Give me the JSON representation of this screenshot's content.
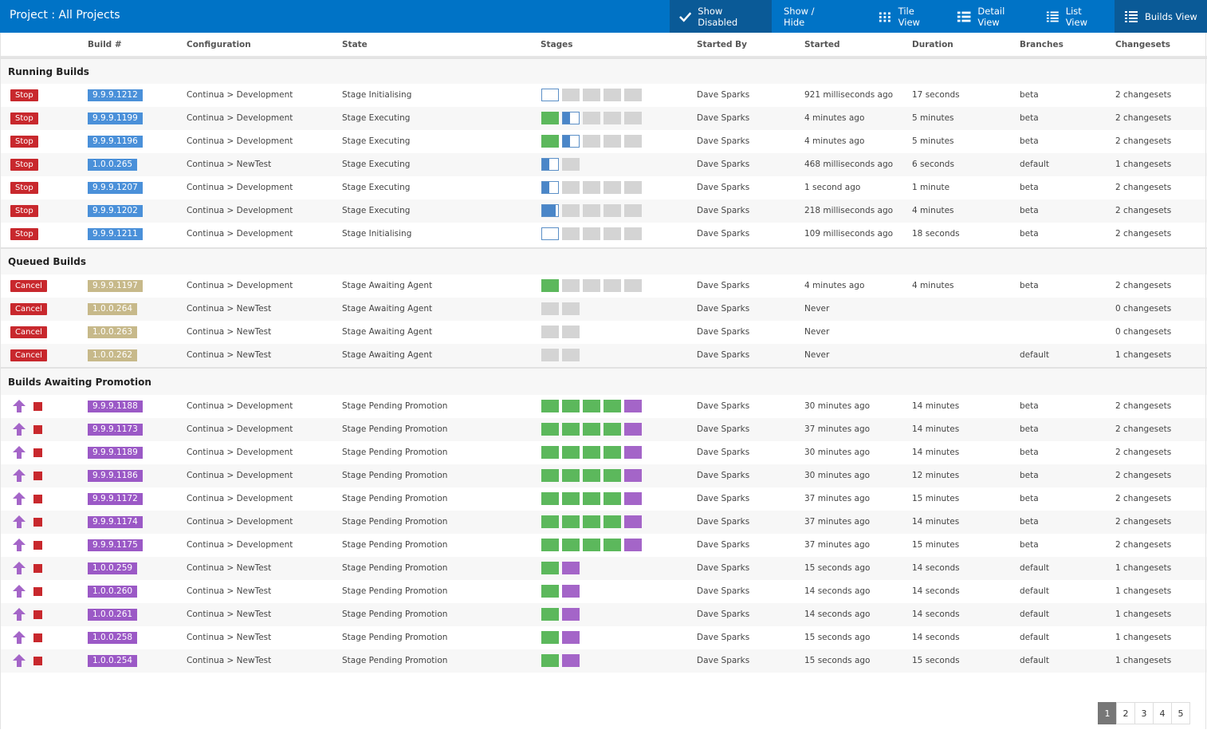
{
  "title": "Project : All Projects",
  "toolbar": {
    "show_disabled": "Show Disabled",
    "show_hide": "Show / Hide",
    "tile_view": "Tile View",
    "detail_view": "Detail View",
    "list_view": "List View",
    "builds_view": "Builds View"
  },
  "columns": [
    "Build #",
    "Configuration",
    "State",
    "Stages",
    "Started By",
    "Started",
    "Duration",
    "Branches",
    "Changesets"
  ],
  "colors": {
    "header": "#0073c6",
    "stop": "#c8282d",
    "running_badge": "#4a90d9",
    "queued_badge": "#c7b98a",
    "promotion_badge": "#9b59c6",
    "stage_done": "#5cb85c",
    "stage_promotion": "#a465c8",
    "stage_pending": "#d4d4d4"
  },
  "sections": {
    "running": {
      "title": "Running Builds",
      "action": "Stop",
      "rows": [
        {
          "build": "9.9.9.1212",
          "config": "Continua > Development",
          "state": "Stage Initialising",
          "stages": [
            "empty",
            "grey",
            "grey",
            "grey",
            "grey"
          ],
          "by": "Dave Sparks",
          "started": "921 milliseconds ago",
          "duration": "17 seconds",
          "branch": "beta",
          "changesets": "2 changesets"
        },
        {
          "build": "9.9.9.1199",
          "config": "Continua > Development",
          "state": "Stage Executing",
          "stages": [
            "green",
            "half",
            "grey",
            "grey",
            "grey"
          ],
          "by": "Dave Sparks",
          "started": "4 minutes ago",
          "duration": "5 minutes",
          "branch": "beta",
          "changesets": "2 changesets"
        },
        {
          "build": "9.9.9.1196",
          "config": "Continua > Development",
          "state": "Stage Executing",
          "stages": [
            "green",
            "half",
            "grey",
            "grey",
            "grey"
          ],
          "by": "Dave Sparks",
          "started": "4 minutes ago",
          "duration": "5 minutes",
          "branch": "beta",
          "changesets": "2 changesets"
        },
        {
          "build": "1.0.0.265",
          "config": "Continua > NewTest",
          "state": "Stage Executing",
          "stages": [
            "half",
            "grey"
          ],
          "by": "Dave Sparks",
          "started": "468 milliseconds ago",
          "duration": "6 seconds",
          "branch": "default",
          "changesets": "1 changesets"
        },
        {
          "build": "9.9.9.1207",
          "config": "Continua > Development",
          "state": "Stage Executing",
          "stages": [
            "half",
            "grey",
            "grey",
            "grey",
            "grey"
          ],
          "by": "Dave Sparks",
          "started": "1 second ago",
          "duration": "1 minute",
          "branch": "beta",
          "changesets": "2 changesets"
        },
        {
          "build": "9.9.9.1202",
          "config": "Continua > Development",
          "state": "Stage Executing",
          "stages": [
            "most",
            "grey",
            "grey",
            "grey",
            "grey"
          ],
          "by": "Dave Sparks",
          "started": "218 milliseconds ago",
          "duration": "4 minutes",
          "branch": "beta",
          "changesets": "2 changesets"
        },
        {
          "build": "9.9.9.1211",
          "config": "Continua > Development",
          "state": "Stage Initialising",
          "stages": [
            "empty",
            "grey",
            "grey",
            "grey",
            "grey"
          ],
          "by": "Dave Sparks",
          "started": "109 milliseconds ago",
          "duration": "18 seconds",
          "branch": "beta",
          "changesets": "2 changesets"
        }
      ]
    },
    "queued": {
      "title": "Queued Builds",
      "action": "Cancel",
      "rows": [
        {
          "build": "9.9.9.1197",
          "config": "Continua > Development",
          "state": "Stage Awaiting Agent",
          "stages": [
            "green",
            "grey",
            "grey",
            "grey",
            "grey"
          ],
          "by": "Dave Sparks",
          "started": "4 minutes ago",
          "duration": "4 minutes",
          "branch": "beta",
          "changesets": "2 changesets"
        },
        {
          "build": "1.0.0.264",
          "config": "Continua > NewTest",
          "state": "Stage Awaiting Agent",
          "stages": [
            "grey",
            "grey"
          ],
          "by": "Dave Sparks",
          "started": "Never",
          "duration": "",
          "branch": "",
          "changesets": "0 changesets"
        },
        {
          "build": "1.0.0.263",
          "config": "Continua > NewTest",
          "state": "Stage Awaiting Agent",
          "stages": [
            "grey",
            "grey"
          ],
          "by": "Dave Sparks",
          "started": "Never",
          "duration": "",
          "branch": "",
          "changesets": "0 changesets"
        },
        {
          "build": "1.0.0.262",
          "config": "Continua > NewTest",
          "state": "Stage Awaiting Agent",
          "stages": [
            "grey",
            "grey"
          ],
          "by": "Dave Sparks",
          "started": "Never",
          "duration": "",
          "branch": "default",
          "changesets": "1 changesets"
        }
      ]
    },
    "promotion": {
      "title": "Builds Awaiting Promotion",
      "rows": [
        {
          "build": "9.9.9.1188",
          "config": "Continua > Development",
          "state": "Stage Pending Promotion",
          "stages": [
            "green",
            "green",
            "green",
            "green",
            "purple"
          ],
          "by": "Dave Sparks",
          "started": "30 minutes ago",
          "duration": "14 minutes",
          "branch": "beta",
          "changesets": "2 changesets"
        },
        {
          "build": "9.9.9.1173",
          "config": "Continua > Development",
          "state": "Stage Pending Promotion",
          "stages": [
            "green",
            "green",
            "green",
            "green",
            "purple"
          ],
          "by": "Dave Sparks",
          "started": "37 minutes ago",
          "duration": "14 minutes",
          "branch": "beta",
          "changesets": "2 changesets"
        },
        {
          "build": "9.9.9.1189",
          "config": "Continua > Development",
          "state": "Stage Pending Promotion",
          "stages": [
            "green",
            "green",
            "green",
            "green",
            "purple"
          ],
          "by": "Dave Sparks",
          "started": "30 minutes ago",
          "duration": "14 minutes",
          "branch": "beta",
          "changesets": "2 changesets"
        },
        {
          "build": "9.9.9.1186",
          "config": "Continua > Development",
          "state": "Stage Pending Promotion",
          "stages": [
            "green",
            "green",
            "green",
            "green",
            "purple"
          ],
          "by": "Dave Sparks",
          "started": "30 minutes ago",
          "duration": "12 minutes",
          "branch": "beta",
          "changesets": "2 changesets"
        },
        {
          "build": "9.9.9.1172",
          "config": "Continua > Development",
          "state": "Stage Pending Promotion",
          "stages": [
            "green",
            "green",
            "green",
            "green",
            "purple"
          ],
          "by": "Dave Sparks",
          "started": "37 minutes ago",
          "duration": "15 minutes",
          "branch": "beta",
          "changesets": "2 changesets"
        },
        {
          "build": "9.9.9.1174",
          "config": "Continua > Development",
          "state": "Stage Pending Promotion",
          "stages": [
            "green",
            "green",
            "green",
            "green",
            "purple"
          ],
          "by": "Dave Sparks",
          "started": "37 minutes ago",
          "duration": "14 minutes",
          "branch": "beta",
          "changesets": "2 changesets"
        },
        {
          "build": "9.9.9.1175",
          "config": "Continua > Development",
          "state": "Stage Pending Promotion",
          "stages": [
            "green",
            "green",
            "green",
            "green",
            "purple"
          ],
          "by": "Dave Sparks",
          "started": "37 minutes ago",
          "duration": "15 minutes",
          "branch": "beta",
          "changesets": "2 changesets"
        },
        {
          "build": "1.0.0.259",
          "config": "Continua > NewTest",
          "state": "Stage Pending Promotion",
          "stages": [
            "green",
            "purple"
          ],
          "by": "Dave Sparks",
          "started": "15 seconds ago",
          "duration": "14 seconds",
          "branch": "default",
          "changesets": "1 changesets"
        },
        {
          "build": "1.0.0.260",
          "config": "Continua > NewTest",
          "state": "Stage Pending Promotion",
          "stages": [
            "green",
            "purple"
          ],
          "by": "Dave Sparks",
          "started": "14 seconds ago",
          "duration": "14 seconds",
          "branch": "default",
          "changesets": "1 changesets"
        },
        {
          "build": "1.0.0.261",
          "config": "Continua > NewTest",
          "state": "Stage Pending Promotion",
          "stages": [
            "green",
            "purple"
          ],
          "by": "Dave Sparks",
          "started": "14 seconds ago",
          "duration": "14 seconds",
          "branch": "default",
          "changesets": "1 changesets"
        },
        {
          "build": "1.0.0.258",
          "config": "Continua > NewTest",
          "state": "Stage Pending Promotion",
          "stages": [
            "green",
            "purple"
          ],
          "by": "Dave Sparks",
          "started": "15 seconds ago",
          "duration": "14 seconds",
          "branch": "default",
          "changesets": "1 changesets"
        },
        {
          "build": "1.0.0.254",
          "config": "Continua > NewTest",
          "state": "Stage Pending Promotion",
          "stages": [
            "green",
            "purple"
          ],
          "by": "Dave Sparks",
          "started": "15 seconds ago",
          "duration": "15 seconds",
          "branch": "default",
          "changesets": "1 changesets"
        }
      ]
    }
  },
  "pagination": {
    "pages": [
      "1",
      "2",
      "3",
      "4",
      "5"
    ],
    "current": "1"
  }
}
